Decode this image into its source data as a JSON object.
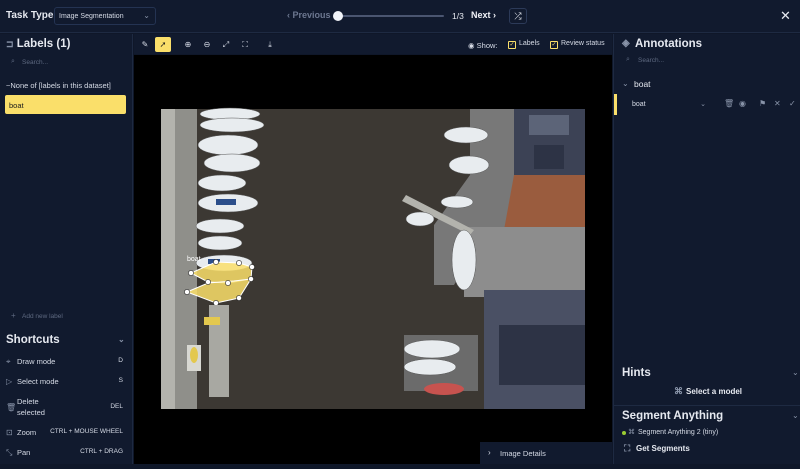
{
  "topbar": {
    "task_type_label": "Task Type:",
    "task_type_value": "Image Segmentation",
    "previous_label": "Previous",
    "page_count": "1/3",
    "next_label": "Next",
    "slider_position": 0
  },
  "left": {
    "title": "Labels (1)",
    "search_placeholder": "Search...",
    "labels": [
      "~None of [labels in this dataset]",
      "boat"
    ],
    "add_placeholder": "Add new label",
    "shortcuts_title": "Shortcuts",
    "shortcuts": [
      {
        "name": "Draw mode",
        "key": "D"
      },
      {
        "name": "Select mode",
        "key": "S"
      },
      {
        "name": "Delete",
        "name2": "selected",
        "key": "DEL"
      },
      {
        "name": "Zoom",
        "key": "CTRL  +  MOUSE WHEEL"
      },
      {
        "name": "Pan",
        "key": "CTRL  +  DRAG"
      }
    ]
  },
  "toolbar": {
    "show_label": "Show:",
    "labels_check": "Labels",
    "review_check": "Review status"
  },
  "canvas": {
    "annotation_label": "boat"
  },
  "image_details": "Image Details",
  "right": {
    "title": "Annotations",
    "search_placeholder": "Search...",
    "group_name": "boat",
    "annotation_select": "boat",
    "hints_title": "Hints",
    "select_model": "Select a model",
    "sa_title": "Segment Anything",
    "sa_model": "Segment Anything 2 (tiny)",
    "get_segments": "Get Segments"
  },
  "colors": {
    "accent": "#fadf6a",
    "panel": "#111a2e",
    "background": "#0f1729"
  }
}
